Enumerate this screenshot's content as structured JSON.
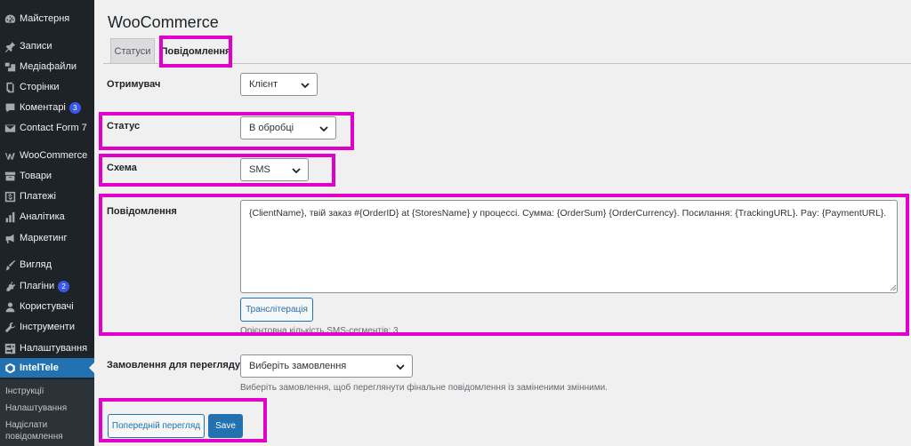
{
  "sidebar": {
    "items": [
      {
        "label": "Майстерня",
        "icon": "dashboard-icon"
      },
      {
        "label": "Записи",
        "icon": "pin-icon"
      },
      {
        "label": "Медіафайли",
        "icon": "media-icon"
      },
      {
        "label": "Сторінки",
        "icon": "page-icon"
      },
      {
        "label": "Коментарі",
        "icon": "comment-icon",
        "badge": "3"
      },
      {
        "label": "Contact Form 7",
        "icon": "mail-icon"
      },
      {
        "label": "WooCommerce",
        "icon": "woocommerce-icon"
      },
      {
        "label": "Товари",
        "icon": "archive-icon"
      },
      {
        "label": "Платежі",
        "icon": "dollar-icon"
      },
      {
        "label": "Аналітика",
        "icon": "bar-chart-icon"
      },
      {
        "label": "Маркетинг",
        "icon": "megaphone-icon"
      },
      {
        "label": "Вигляд",
        "icon": "brush-icon"
      },
      {
        "label": "Плагіни",
        "icon": "plugin-icon",
        "badge": "2"
      },
      {
        "label": "Користувачі",
        "icon": "users-icon"
      },
      {
        "label": "Інструменти",
        "icon": "wrench-icon"
      },
      {
        "label": "Налаштування",
        "icon": "settings-icon"
      },
      {
        "label": "IntelTele",
        "icon": "inteltele-icon",
        "active": true
      }
    ],
    "submenu": [
      {
        "label": "Інструкції"
      },
      {
        "label": "Налаштування"
      },
      {
        "label": "Надіслати повідомлення"
      }
    ]
  },
  "page": {
    "title": "WooCommerce"
  },
  "tabs": [
    {
      "label": "Статуси",
      "active": false
    },
    {
      "label": "Повідомлення",
      "active": true
    }
  ],
  "form": {
    "recipient": {
      "label": "Отримувач",
      "value": "Клієнт"
    },
    "status": {
      "label": "Статус",
      "value": "В обробці"
    },
    "scheme": {
      "label": "Схема",
      "value": "SMS"
    },
    "message": {
      "label": "Повідомлення",
      "value": "{ClientName}, твій заказ #{OrderID} at {StoresName} у процессі. Сумма: {OrderSum} {OrderCurrency}. Посилання: {TrackingURL}. Pay: {PaymentURL}.",
      "transliterate_button": "Транслітерація",
      "segments_note": "Орієнтовна кількість SMS-сегментів: 3"
    },
    "preview_order": {
      "label": "Замовлення для перегляду",
      "value": "Виберіть замовлення",
      "description": "Виберіть замовлення, щоб переглянути фінальне повідомлення із заміненими змінними."
    }
  },
  "actions": {
    "preview_button": "Попередній перегляд",
    "save_button": "Save"
  },
  "colors": {
    "accent": "#2271b1",
    "highlight": "#e000c8",
    "sidebar_bg": "#1d2327",
    "badge": "#3858e9"
  }
}
